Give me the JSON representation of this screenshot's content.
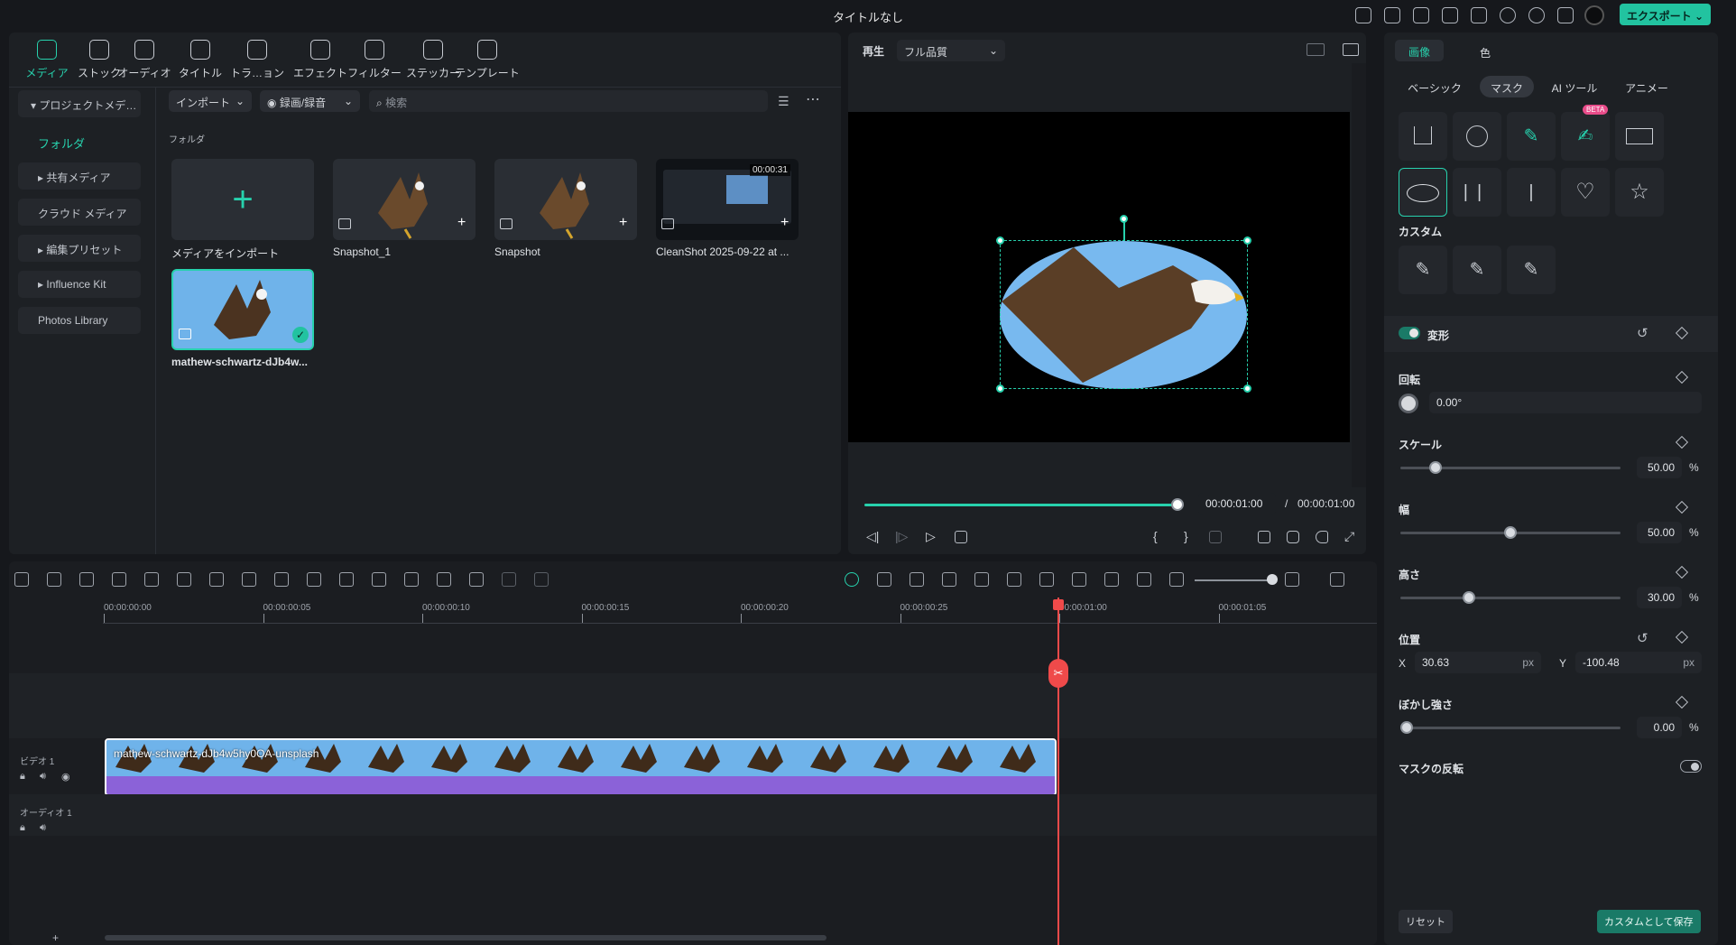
{
  "app": {
    "title": "タイトルなし",
    "export_label": "エクスポート"
  },
  "toolbar_tabs": [
    {
      "label": "メディア",
      "icon": "media-icon"
    },
    {
      "label": "ストック",
      "icon": "stock-icon"
    },
    {
      "label": "オーディオ",
      "icon": "audio-icon"
    },
    {
      "label": "タイトル",
      "icon": "title-icon"
    },
    {
      "label": "トラ…ョン",
      "icon": "transition-icon"
    },
    {
      "label": "エフェクト",
      "icon": "effect-icon"
    },
    {
      "label": "フィルター",
      "icon": "filter-icon"
    },
    {
      "label": "ステッカー",
      "icon": "sticker-icon"
    },
    {
      "label": "テンプレート",
      "icon": "template-icon"
    }
  ],
  "sidebar": {
    "project_media": "プロジェクトメデ…",
    "folder": "フォルダ",
    "items": [
      "共有メディア",
      "クラウド メディア",
      "編集プリセット",
      "Influence Kit",
      "Photos Library"
    ]
  },
  "media": {
    "import_label": "インポート",
    "record_label": "録画/録音",
    "search_placeholder": "検索",
    "section_label": "フォルダ",
    "import_tile_label": "メディアをインポート",
    "items": [
      {
        "label": "Snapshot_1"
      },
      {
        "label": "Snapshot"
      },
      {
        "label": "CleanShot 2025-09-22 at ...",
        "duration": "00:00:31"
      },
      {
        "label": "mathew-schwartz-dJb4w..."
      }
    ]
  },
  "preview": {
    "play_label": "再生",
    "quality": "フル品質",
    "current_time": "00:00:01:00",
    "total_time": "00:00:01:00",
    "separator": "/",
    "progress": 1.0
  },
  "right_panel": {
    "tabs": [
      "画像",
      "色"
    ],
    "subtabs": [
      "ベーシック",
      "マスク",
      "AI ツール",
      "アニメー"
    ],
    "beta_label": "BETA",
    "custom_label": "カスタム",
    "transform_label": "変形",
    "rotation": {
      "label": "回転",
      "value": "0.00°"
    },
    "scale": {
      "label": "スケール",
      "value": "50.00",
      "unit": "%",
      "level": 0.14
    },
    "width": {
      "label": "幅",
      "value": "50.00",
      "unit": "%",
      "level": 0.5
    },
    "height": {
      "label": "高さ",
      "value": "30.00",
      "unit": "%",
      "level": 0.3
    },
    "position": {
      "label": "位置",
      "x_label": "X",
      "x": "30.63",
      "y_label": "Y",
      "y": "-100.48",
      "unit": "px"
    },
    "blur": {
      "label": "ぼかし強さ",
      "value": "0.00",
      "unit": "%",
      "level": 0
    },
    "invert_label": "マスクの反転",
    "reset_label": "リセット",
    "save_custom_label": "カスタムとして保存"
  },
  "timeline": {
    "ruler": [
      "00:00:00:00",
      "00:00:00:05",
      "00:00:00:10",
      "00:00:00:15",
      "00:00:00:20",
      "00:00:00:25",
      "00:00:01:00",
      "00:00:01:05"
    ],
    "video_track": "ビデオ 1",
    "audio_track": "オーディオ 1",
    "clip_label": "mathew-schwartz-dJb4w5hy0OA-unsplash",
    "add_track": "+"
  },
  "colors": {
    "accent": "#22c3a0",
    "playhead": "#ef4a4a",
    "clip": "#8b62d8"
  }
}
